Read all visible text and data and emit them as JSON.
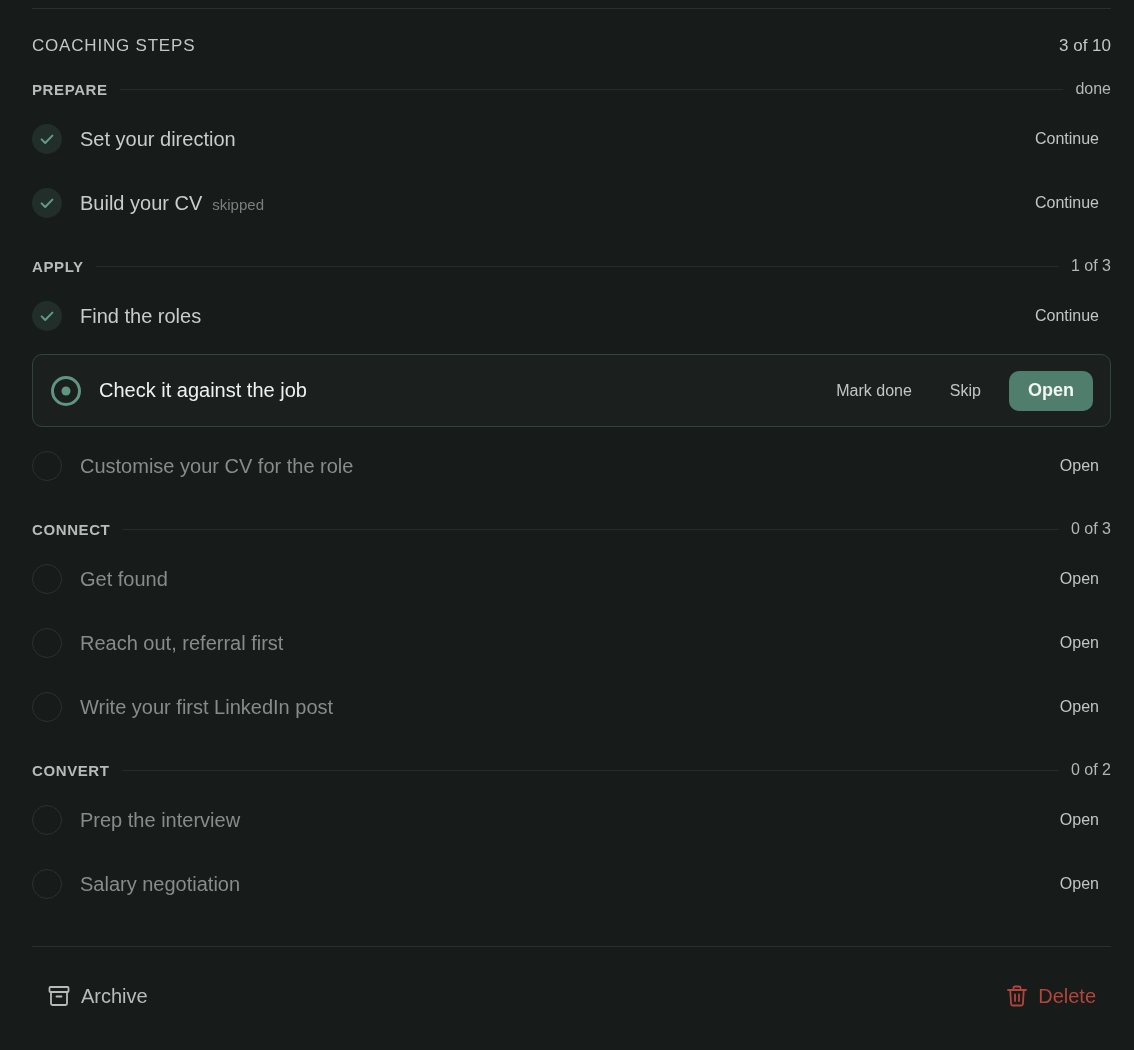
{
  "heading": {
    "title": "COACHING STEPS",
    "count": "3 of 10"
  },
  "sections": [
    {
      "label": "PREPARE",
      "count": "done",
      "steps": [
        {
          "title": "Set your direction",
          "done": true,
          "current": false,
          "actions": [
            {
              "label": "Continue",
              "kind": "link"
            }
          ]
        },
        {
          "title": "Build your CV",
          "note": "skipped",
          "done": true,
          "current": false,
          "actions": [
            {
              "label": "Continue",
              "kind": "link"
            }
          ]
        }
      ]
    },
    {
      "label": "APPLY",
      "count": "1 of 3",
      "steps": [
        {
          "title": "Find the roles",
          "done": true,
          "current": false,
          "actions": [
            {
              "label": "Continue",
              "kind": "link"
            }
          ]
        },
        {
          "title": "Check it against the job",
          "done": false,
          "current": true,
          "actions": [
            {
              "label": "Mark done",
              "kind": "link"
            },
            {
              "label": "Skip",
              "kind": "link"
            },
            {
              "label": "Open",
              "kind": "primary"
            }
          ]
        },
        {
          "title": "Customise your CV for the role",
          "done": false,
          "current": false,
          "actions": [
            {
              "label": "Open",
              "kind": "link"
            }
          ]
        }
      ]
    },
    {
      "label": "CONNECT",
      "count": "0 of 3",
      "steps": [
        {
          "title": "Get found",
          "done": false,
          "current": false,
          "actions": [
            {
              "label": "Open",
              "kind": "link"
            }
          ]
        },
        {
          "title": "Reach out, referral first",
          "done": false,
          "current": false,
          "actions": [
            {
              "label": "Open",
              "kind": "link"
            }
          ]
        },
        {
          "title": "Write your first LinkedIn post",
          "done": false,
          "current": false,
          "actions": [
            {
              "label": "Open",
              "kind": "link"
            }
          ]
        }
      ]
    },
    {
      "label": "CONVERT",
      "count": "0 of 2",
      "steps": [
        {
          "title": "Prep the interview",
          "done": false,
          "current": false,
          "actions": [
            {
              "label": "Open",
              "kind": "link"
            }
          ]
        },
        {
          "title": "Salary negotiation",
          "done": false,
          "current": false,
          "actions": [
            {
              "label": "Open",
              "kind": "link"
            }
          ]
        }
      ]
    }
  ],
  "footer": {
    "buttons": [
      {
        "label": "Archive",
        "kind": "archive"
      },
      {
        "label": "Delete",
        "kind": "delete"
      }
    ]
  }
}
